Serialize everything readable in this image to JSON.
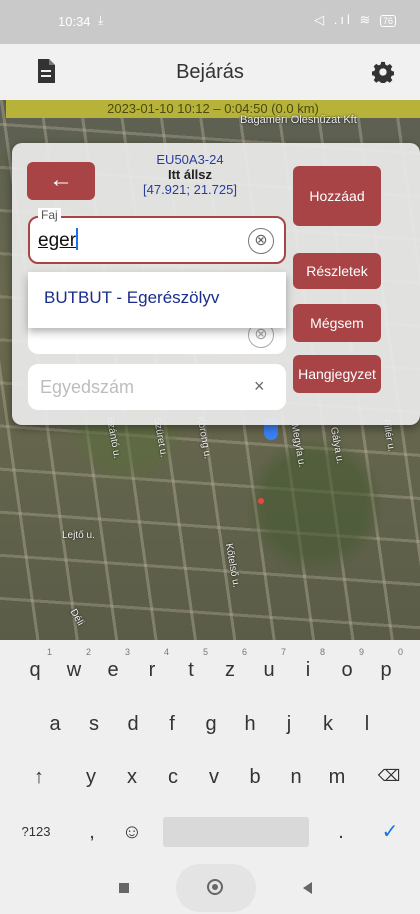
{
  "status_bar": {
    "time": "10:34",
    "download_icon": "download-icon",
    "signal_icons": "◁ .ıl ≋",
    "battery": "76"
  },
  "header": {
    "title": "Bejárás",
    "left_icon": "document-icon",
    "right_icon": "gear-icon"
  },
  "map": {
    "trip_info": "2023-01-10 10:12 – 0:04:50 (0.0 km)",
    "company_label": "Bagamérı Olesnűzat Kft",
    "road_labels": [
      "Szántó u.",
      "Szüret u.",
      "Korong u.",
      "Megyfa u.",
      "Gálya u.",
      "Fillér u.",
      "Lejtő u.",
      "Kőtelső u.",
      "Déli"
    ]
  },
  "panel": {
    "back_label": "←",
    "code": "EU50A3-24",
    "here_label": "Itt állsz",
    "coords": "[47.921; 21.725]",
    "species_label": "Faj",
    "species_value": "eger",
    "clear_symbol": "⊗",
    "suggestion": "BUTBUT - Egerészölyv",
    "count_placeholder": "Egyedszám",
    "count_clear": "×"
  },
  "buttons": {
    "add": "Hozzáad",
    "details": "Részletek",
    "cancel": "Mégsem",
    "note": "Hangjegyzet"
  },
  "keyboard": {
    "row1": [
      "q",
      "w",
      "e",
      "r",
      "t",
      "z",
      "u",
      "i",
      "o",
      "p"
    ],
    "row1_hints": [
      "1",
      "2",
      "3",
      "4",
      "5",
      "6",
      "7",
      "8",
      "9",
      "0"
    ],
    "row2": [
      "a",
      "s",
      "d",
      "f",
      "g",
      "h",
      "j",
      "k",
      "l"
    ],
    "row3": [
      "↑",
      "y",
      "x",
      "c",
      "v",
      "b",
      "n",
      "m",
      "⌫"
    ],
    "row4": [
      "?123",
      ",",
      "☺",
      ".",
      "✓"
    ]
  }
}
